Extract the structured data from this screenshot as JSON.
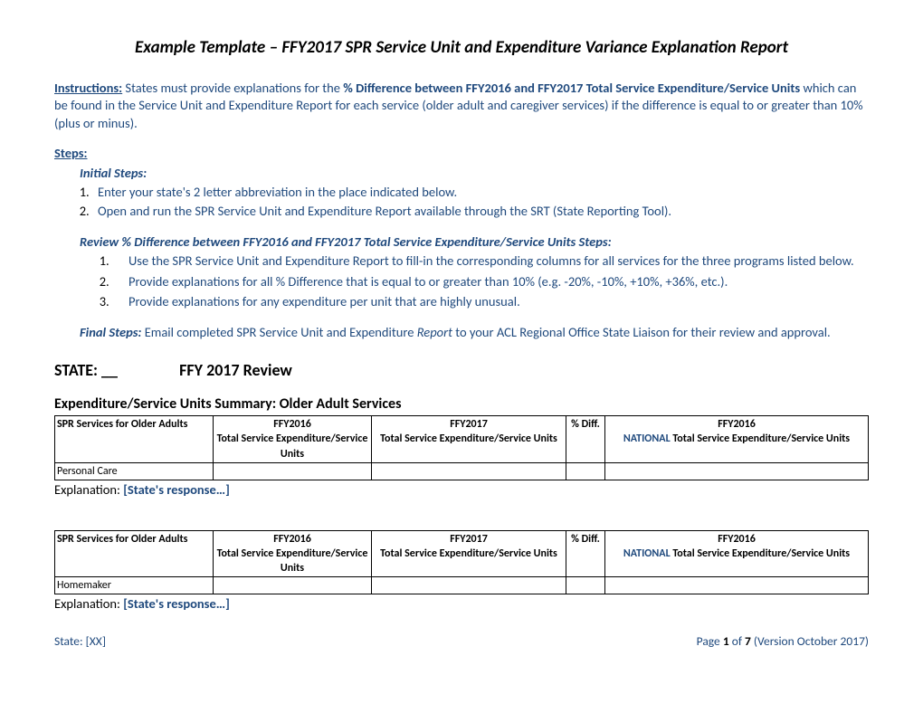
{
  "title": "Example Template – FFY2017 SPR Service Unit and Expenditure Variance Explanation Report",
  "instructions": {
    "label": "Instructions:",
    "part1": "  States must provide explanations for the ",
    "bold1": "% Difference between FFY2016 and FFY2017 Total Service Expenditure/Service Units",
    "part2": " which can be found in the Service Unit and Expenditure Report for each service (older adult and caregiver services) if the difference is equal to or greater than 10% (plus or minus)."
  },
  "stepsLabel": "Steps:",
  "initialStepsLabel": "Initial Steps:",
  "initialSteps": [
    "Enter your state's 2 letter abbreviation in the place indicated below.",
    "Open and run the SPR Service Unit and Expenditure Report available through the SRT (State Reporting Tool)."
  ],
  "reviewHeading": "Review % Difference between FFY2016 and FFY2017 Total Service Expenditure/Service Units Steps:",
  "reviewSteps": [
    "Use the SPR Service Unit and Expenditure Report to fill-in the corresponding columns for all services for the three programs listed below.",
    "Provide explanations for all % Difference that is equal to or greater than 10% (e.g. -20%, -10%, +10%, +36%, etc.).",
    "Provide explanations for any expenditure per unit that are highly unusual."
  ],
  "finalSteps": {
    "label": "Final Steps:",
    "part1": "  Email completed SPR Service Unit and Expenditure ",
    "italic": "Report",
    "part2": " to your ACL Regional Office State Liaison for their review and approval."
  },
  "stateLine": {
    "stateLabel": "STATE: __",
    "reviewLabel": "FFY 2017 Review"
  },
  "summaryHeading": "Expenditure/Service Units Summary: Older Adult Services",
  "tableHeaders": {
    "col1": "SPR Services for Older Adults",
    "col2a": "FFY2016",
    "col2b": "Total Service Expenditure/Service Units",
    "col3a": "FFY2017",
    "col3b": "Total Service Expenditure/Service Units",
    "col4": "% Diff.",
    "col5a": "FFY2016",
    "col5b_national": "NATIONAL",
    "col5b_rest": " Total Service Expenditure/Service Units"
  },
  "tables": [
    {
      "service": "Personal Care"
    },
    {
      "service": "Homemaker"
    }
  ],
  "explanation": {
    "label": "Explanation: ",
    "response": "[State's response…]"
  },
  "footer": {
    "left": "State: [XX]",
    "rightPage": "Page ",
    "rightNum": "1",
    "rightOf": " of ",
    "rightTotal": "7",
    "rightVersion": " (Version October 2017)"
  }
}
